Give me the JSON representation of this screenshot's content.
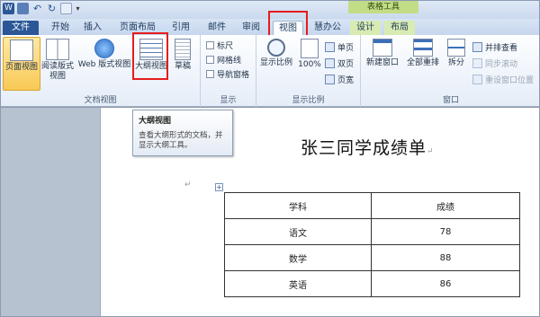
{
  "titlebar": {
    "context_tab_group": "表格工具"
  },
  "tabs": {
    "file": "文件",
    "home": "开始",
    "insert": "插入",
    "layout": "页面布局",
    "references": "引用",
    "mailings": "邮件",
    "review": "审阅",
    "view": "视图",
    "extra": "慧办公",
    "design": "设计",
    "table_layout": "布局"
  },
  "ribbon": {
    "doc_views": {
      "print_layout": "页面视图",
      "full_reading": "阅读版式视图",
      "web": "Web 版式视图",
      "outline": "大纲视图",
      "draft": "草稿",
      "label": "文档视图"
    },
    "show": {
      "ruler": "标尺",
      "gridlines": "网格线",
      "nav_pane": "导航窗格",
      "label": "显示"
    },
    "zoom": {
      "zoom": "显示比例",
      "percent": "100%",
      "one_page": "单页",
      "two_pages": "双页",
      "page_width": "页宽",
      "label": "显示比例"
    },
    "window": {
      "new_window": "新建窗口",
      "arrange_all": "全部重排",
      "split": "拆分",
      "side_by_side": "并排查看",
      "sync_scroll": "同步滚动",
      "reset_position": "重设窗口位置",
      "label": "窗口"
    }
  },
  "tooltip": {
    "title": "大纲视图",
    "description": "查看大纲形式的文档，并显示大纲工具。"
  },
  "document": {
    "title": "张三同学成绩单",
    "table": {
      "headers": [
        "学科",
        "成绩"
      ],
      "rows": [
        [
          "语文",
          "78"
        ],
        [
          "数学",
          "88"
        ],
        [
          "英语",
          "86"
        ]
      ]
    }
  }
}
